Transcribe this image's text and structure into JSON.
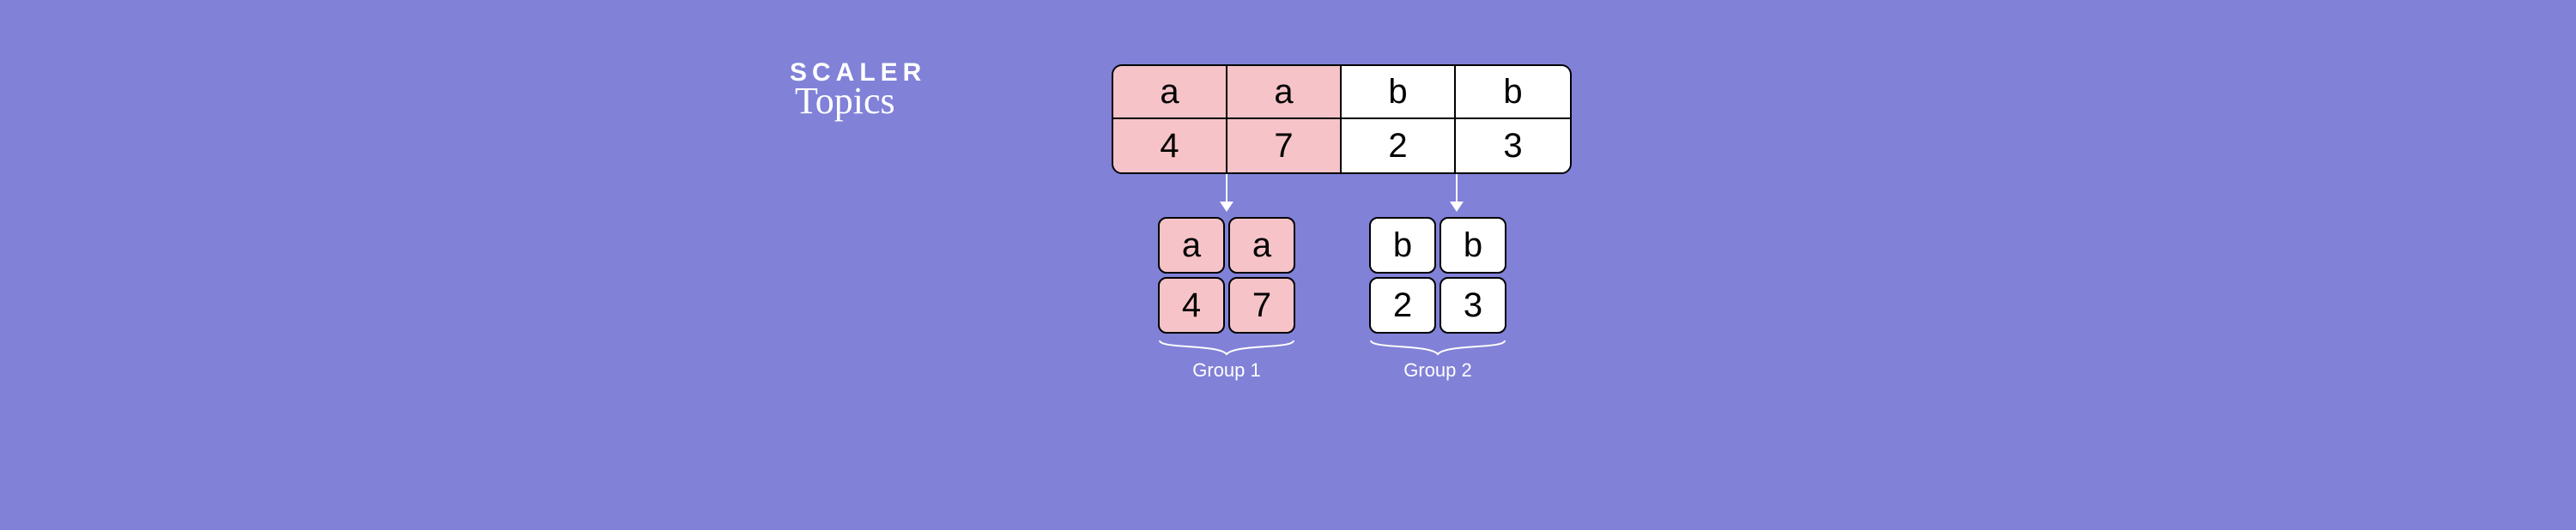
{
  "logo": {
    "main": "SCALER",
    "sub": "Topics"
  },
  "table": {
    "keys": [
      "a",
      "a",
      "b",
      "b"
    ],
    "values": [
      "4",
      "7",
      "2",
      "3"
    ],
    "highlight_cols": [
      0,
      1
    ]
  },
  "arrows": [
    {
      "from_col_boundary": 1
    },
    {
      "from_col_boundary": 3
    }
  ],
  "groups": [
    {
      "label": "Group 1",
      "color": "pink",
      "cells": [
        "a",
        "a",
        "4",
        "7"
      ]
    },
    {
      "label": "Group 2",
      "color": "white",
      "cells": [
        "b",
        "b",
        "2",
        "3"
      ]
    }
  ],
  "colors": {
    "pink": "#f6c3c8",
    "white": "#ffffff",
    "bg": "#8181d8"
  }
}
